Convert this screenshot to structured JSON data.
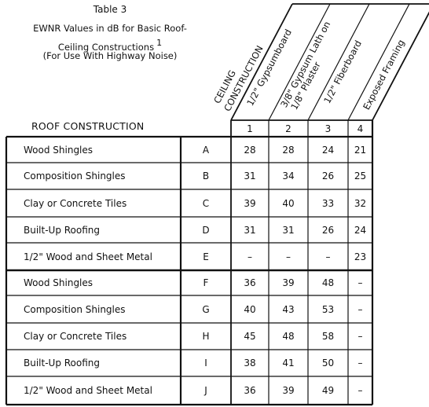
{
  "title": {
    "table_number": "Table 3",
    "line1": "EWNR Values in dB for Basic Roof-",
    "line2": "Ceiling Constructions",
    "footnote_marker": "1",
    "line3": "(For Use With Highway Noise)"
  },
  "roof_heading": "ROOF CONSTRUCTION",
  "ceiling_heading": [
    "CEILING",
    "CONSTRUCTION"
  ],
  "columns": [
    {
      "number": "1",
      "label": [
        "1/2\" Gypsumboard"
      ]
    },
    {
      "number": "2",
      "label": [
        "3/8\" Gypsum Lath on",
        "1/8\" Plaster"
      ]
    },
    {
      "number": "3",
      "label": [
        "1/2\" Fiberboard"
      ]
    },
    {
      "number": "4",
      "label": [
        "Exposed Framing"
      ]
    }
  ],
  "rows": [
    {
      "roof": "Wood Shingles",
      "code": "A",
      "values": [
        "28",
        "28",
        "24",
        "21"
      ]
    },
    {
      "roof": "Composition Shingles",
      "code": "B",
      "values": [
        "31",
        "34",
        "26",
        "25"
      ]
    },
    {
      "roof": "Clay or Concrete Tiles",
      "code": "C",
      "values": [
        "39",
        "40",
        "33",
        "32"
      ]
    },
    {
      "roof": "Built-Up Roofing",
      "code": "D",
      "values": [
        "31",
        "31",
        "26",
        "24"
      ]
    },
    {
      "roof": "1/2\" Wood and Sheet Metal",
      "code": "E",
      "values": [
        "–",
        "–",
        "–",
        "23"
      ]
    },
    {
      "roof": "Wood Shingles",
      "code": "F",
      "values": [
        "36",
        "39",
        "48",
        "–"
      ]
    },
    {
      "roof": "Composition Shingles",
      "code": "G",
      "values": [
        "40",
        "43",
        "53",
        "–"
      ]
    },
    {
      "roof": "Clay or Concrete Tiles",
      "code": "H",
      "values": [
        "45",
        "48",
        "58",
        "–"
      ]
    },
    {
      "roof": "Built-Up Roofing",
      "code": "I",
      "values": [
        "38",
        "41",
        "50",
        "–"
      ]
    },
    {
      "roof": "1/2\" Wood and Sheet Metal",
      "code": "J",
      "values": [
        "36",
        "39",
        "49",
        "–"
      ]
    }
  ]
}
